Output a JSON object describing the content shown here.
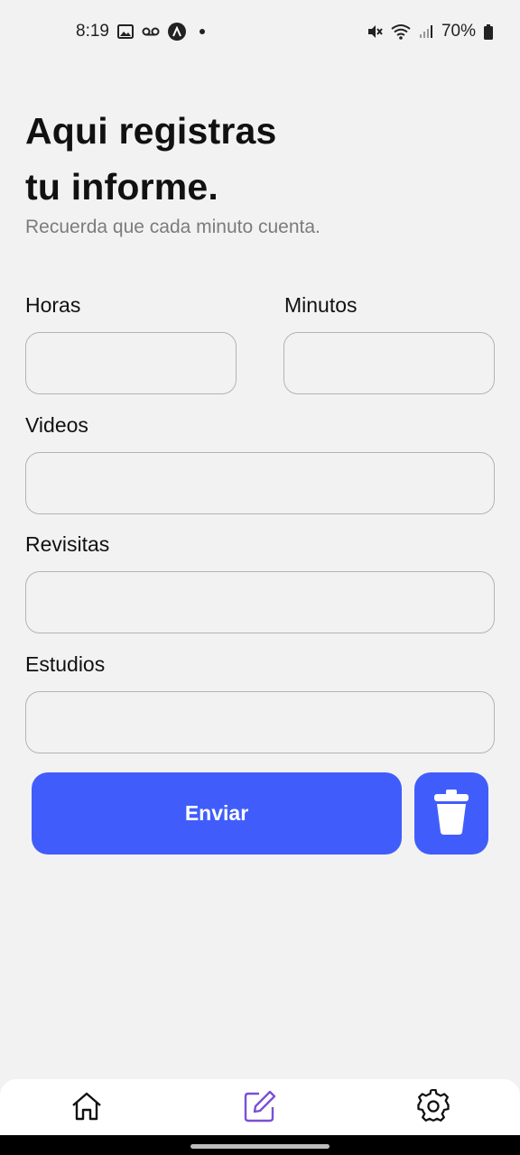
{
  "status_bar": {
    "time": "8:19",
    "battery": "70%",
    "left_icons": [
      "image-icon",
      "voicemail-icon",
      "app-a-icon",
      "dot-icon"
    ],
    "right_icons": [
      "mute-icon",
      "wifi-icon",
      "signal-icon",
      "battery-icon"
    ]
  },
  "header": {
    "title": "Aqui registras\ntu informe.",
    "subtitle": "Recuerda que cada minuto cuenta."
  },
  "form": {
    "horas": {
      "label": "Horas",
      "value": "",
      "placeholder": ""
    },
    "minutos": {
      "label": "Minutos",
      "value": "",
      "placeholder": ""
    },
    "videos": {
      "label": "Videos",
      "value": "",
      "placeholder": ""
    },
    "revisitas": {
      "label": "Revisitas",
      "value": "",
      "placeholder": ""
    },
    "estudios": {
      "label": "Estudios",
      "value": "",
      "placeholder": ""
    }
  },
  "actions": {
    "send_label": "Enviar",
    "delete_icon": "trash-icon"
  },
  "bottom_nav": {
    "items": [
      {
        "icon": "home-icon",
        "active": false
      },
      {
        "icon": "edit-icon",
        "active": true
      },
      {
        "icon": "gear-icon",
        "active": false
      }
    ]
  },
  "colors": {
    "background": "#f2f2f2",
    "accent": "#405dfc",
    "active_nav": "#7b4fd6",
    "field_border": "#b3b3b3",
    "subtitle": "#7c7c7c"
  }
}
